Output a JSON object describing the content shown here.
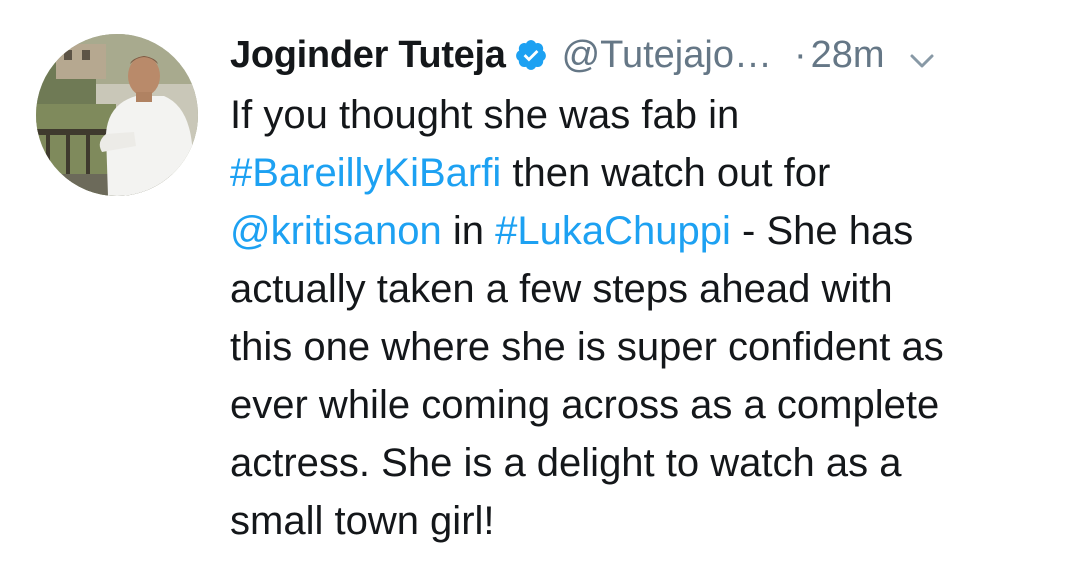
{
  "tweet": {
    "author_name": "Joginder Tuteja",
    "handle": "@Tutejajo…",
    "separator": "·",
    "time": "28m",
    "text_lines": [
      [
        {
          "t": "If you thought she was fab in",
          "link": false
        }
      ],
      [
        {
          "t": "#BareillyKiBarfi",
          "link": true
        },
        {
          "t": " then watch out for",
          "link": false
        }
      ],
      [
        {
          "t": "@kritisanon",
          "link": true
        },
        {
          "t": " in ",
          "link": false
        },
        {
          "t": "#LukaChuppi",
          "link": true
        },
        {
          "t": " - She has",
          "link": false
        }
      ],
      [
        {
          "t": "actually taken a few steps ahead with",
          "link": false
        }
      ],
      [
        {
          "t": "this one where she is super confident as",
          "link": false
        }
      ],
      [
        {
          "t": "ever while coming across as a complete",
          "link": false
        }
      ],
      [
        {
          "t": "actress. She is a delight to watch as a",
          "link": false
        }
      ],
      [
        {
          "t": "small town girl!",
          "link": false
        }
      ]
    ]
  },
  "icons": {
    "verified": "verified-badge-icon",
    "more": "chevron-down-icon"
  },
  "colors": {
    "text": "#14171a",
    "secondary": "#657786",
    "link": "#1da1f2",
    "verified": "#1da1f2"
  }
}
